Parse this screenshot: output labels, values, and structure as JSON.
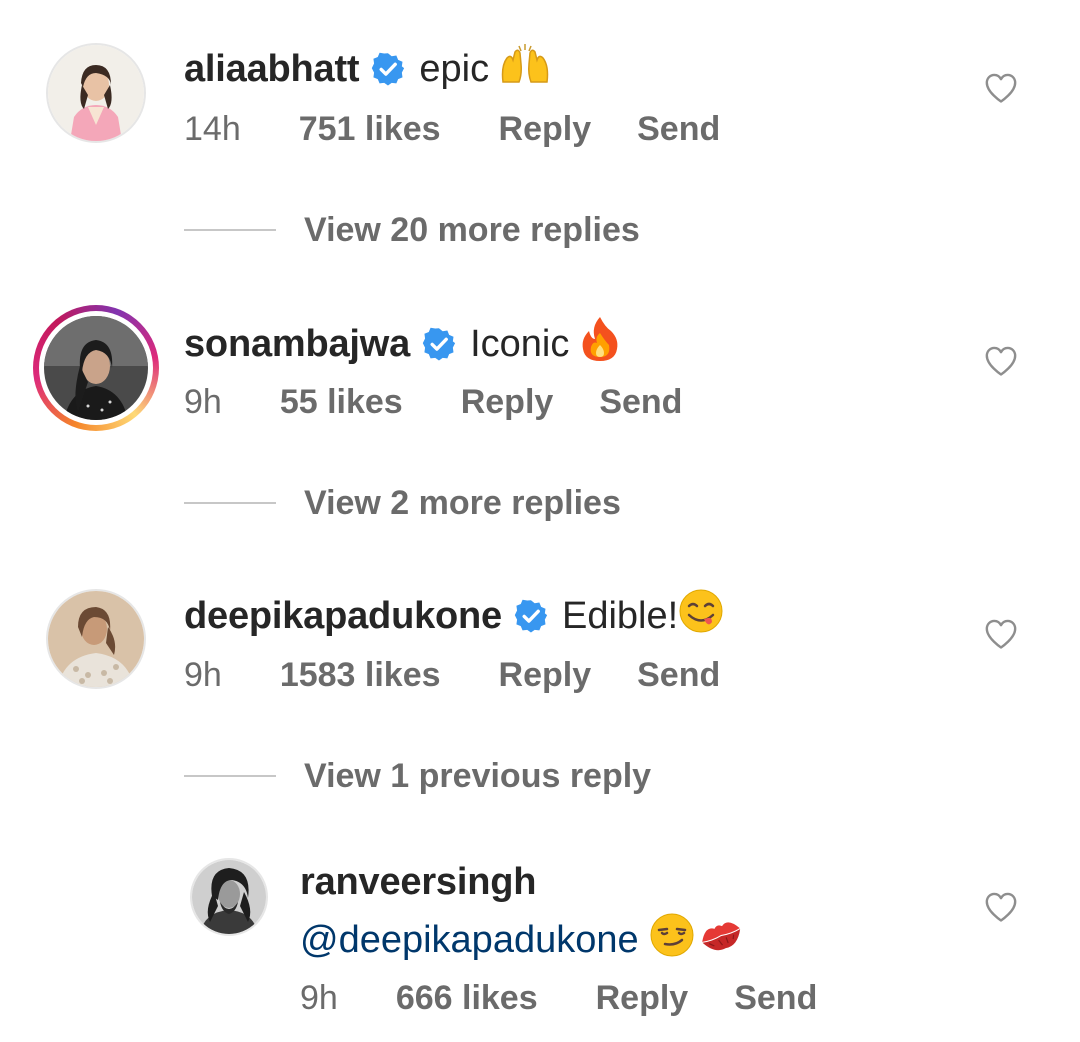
{
  "comments": [
    {
      "username": "aliaabhatt",
      "text": "epic",
      "emoji": "raising-hands",
      "time": "14h",
      "likes": "751 likes",
      "reply": "Reply",
      "send": "Send",
      "verified": true,
      "view_replies": "View 20 more replies"
    },
    {
      "username": "sonambajwa",
      "text": "Iconic",
      "emoji": "fire",
      "time": "9h",
      "likes": "55 likes",
      "reply": "Reply",
      "send": "Send",
      "verified": true,
      "has_story": true,
      "view_replies": "View 2 more replies"
    },
    {
      "username": "deepikapadukone",
      "text": "Edible!",
      "emoji": "face-savoring-food",
      "time": "9h",
      "likes": "1583 likes",
      "reply": "Reply",
      "send": "Send",
      "verified": true,
      "view_replies": "View 1 previous reply"
    }
  ],
  "reply": {
    "username": "ranveersingh",
    "mention": "@deepikapadukone",
    "emojis": [
      "smirking-face",
      "kiss-mark"
    ],
    "time": "9h",
    "likes": "666 likes",
    "reply": "Reply",
    "send": "Send"
  },
  "colors": {
    "text": "#262626",
    "secondary": "#6b6b6b",
    "verified": "#3897f0",
    "mention": "#00376b",
    "divider": "#c7c7c7"
  }
}
